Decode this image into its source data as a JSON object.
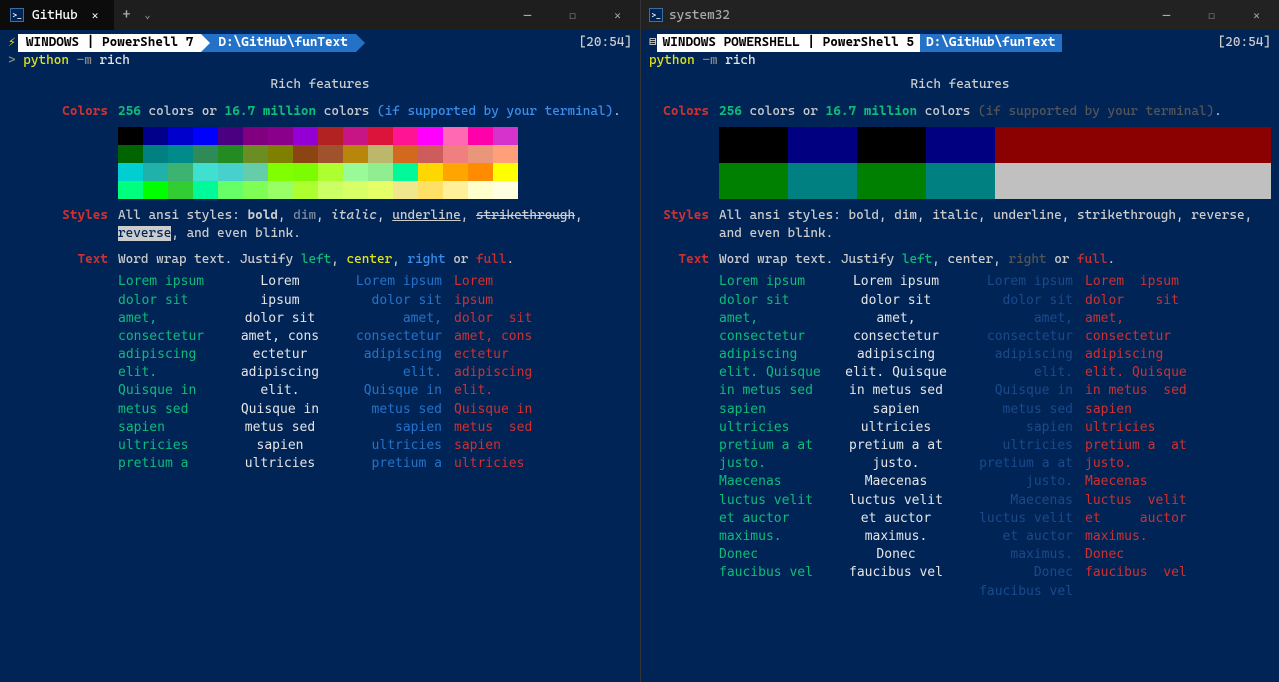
{
  "left": {
    "tab_title": "GitHub",
    "time": "[20:54]",
    "prompt_host": "WINDOWS | PowerShell 7",
    "prompt_path": "D:\\GitHub\\funText",
    "cmd_prefix": ">",
    "cmd_python": "python",
    "cmd_flag": "-m",
    "cmd_arg": "rich",
    "heading": "Rich features",
    "colors_label": "Colors",
    "colors_256": "256",
    "colors_text1": "colors or",
    "colors_million": "16.7 million",
    "colors_text2": "colors",
    "colors_supp": "(if supported by your terminal)",
    "dot": ".",
    "styles_label": "Styles",
    "styles_text": "All ansi styles:",
    "styles_bold": "bold",
    "styles_dim": "dim",
    "styles_italic": "italic",
    "styles_underline": "underline",
    "styles_strike": "strikethrough",
    "styles_reverse": "reverse",
    "styles_tail": ", and even blink.",
    "text_label": "Text",
    "text_prefix": "Word wrap text. Justify",
    "text_left": "left",
    "text_center": "center",
    "text_right": "right",
    "text_or": "or",
    "text_full": "full",
    "lorem_left": "Lorem ipsum\ndolor sit\namet,\nconsectetur\nadipiscing\nelit.\nQuisque in\nmetus sed\nsapien\nultricies\npretium a",
    "lorem_center": "Lorem\nipsum\ndolor sit\namet, cons\nectetur\nadipiscing\nelit.\nQuisque in\nmetus sed\nsapien\nultricies",
    "lorem_right": "Lorem ipsum\ndolor sit\namet,\nconsectetur\nadipiscing\nelit.\nQuisque in\nmetus sed\nsapien\nultricies\npretium a",
    "lorem_full": "Lorem\nipsum\ndolor  sit\namet, cons\nectetur\nadipiscing\nelit.\nQuisque in\nmetus  sed\nsapien\nultricies"
  },
  "right": {
    "tab_title": "system32",
    "time": "[20:54]",
    "prompt_host": "WINDOWS POWERSHELL | PowerShell 5",
    "prompt_path": "D:\\GitHub\\funText",
    "cmd_python": "python",
    "cmd_flag": "-m",
    "cmd_arg": "rich",
    "heading": "Rich features",
    "colors_label": "Colors",
    "colors_256": "256",
    "colors_text1": "colors or",
    "colors_million": "16.7 million",
    "colors_text2": "colors",
    "colors_supp": "(if supported by your terminal)",
    "dot": ".",
    "styles_label": "Styles",
    "styles_body": "All ansi styles: bold, dim, italic, underline, strikethrough, reverse, and even blink.",
    "text_label": "Text",
    "text_prefix": "Word wrap text. Justify",
    "text_left": "left",
    "text_center": "center",
    "text_right": "right",
    "text_or": "or",
    "text_full": "full",
    "lorem": "Lorem ipsum\ndolor sit\namet,\nconsectetur\nadipiscing\nelit. Quisque\nin metus sed\nsapien\nultricies\npretium a at\njusto.\nMaecenas\nluctus velit\net auctor\nmaximus.\nDonec\nfaucibus vel",
    "lorem_right_col": "Lorem ipsum\ndolor sit\namet,\nconsectetur\nadipiscing\nelit.\nQuisque in\nmetus sed\nsapien\nultricies\npretium a at\njusto.\nMaecenas\nluctus velit\net auctor\nmaximus.\nDonec\nfaucibus vel",
    "lorem_full_col": "Lorem  ipsum\ndolor    sit\namet,\nconsectetur\nadipiscing\nelit. Quisque\nin metus  sed\nsapien\nultricies\npretium a  at\njusto.\nMaecenas\nluctus  velit\net     auctor\nmaximus.\nDonec\nfaucibus  vel"
  },
  "swatches_left": [
    [
      "#000000",
      "#00008b",
      "#0000cd",
      "#0000ff",
      "#4b0082",
      "#800080",
      "#8b008b",
      "#9400d3",
      "#b22222",
      "#c71585",
      "#dc143c",
      "#ff1493",
      "#ff00ff",
      "#ff69b4",
      "#ff00aa",
      "#d633cc"
    ],
    [
      "#006400",
      "#008080",
      "#008b8b",
      "#2e8b57",
      "#228b22",
      "#6b8e23",
      "#808000",
      "#8b4513",
      "#a0522d",
      "#b8860b",
      "#bdb76b",
      "#d2691e",
      "#cd5c5c",
      "#f08080",
      "#e9967a",
      "#ffa07a"
    ],
    [
      "#00ced1",
      "#20b2aa",
      "#3cb371",
      "#40e0d0",
      "#48d1cc",
      "#66cdaa",
      "#7fff00",
      "#7cfc00",
      "#adff2f",
      "#98fb98",
      "#90ee90",
      "#00fa9a",
      "#ffd700",
      "#ffa500",
      "#ff8c00",
      "#ffff00"
    ],
    [
      "#00ff7f",
      "#00ff00",
      "#32cd32",
      "#00fa9a",
      "#66ff66",
      "#7fff55",
      "#99ff66",
      "#adff2f",
      "#ccff66",
      "#d9ff66",
      "#e6ff66",
      "#f0e68c",
      "#ffe066",
      "#fff099",
      "#ffffcc",
      "#ffffe0"
    ]
  ],
  "swatches_right": [
    [
      "#000000",
      "#000080",
      "#000000",
      "#000080",
      "#8b0000",
      "#8b0000",
      "#8b0000",
      "#8b0000"
    ],
    [
      "#008000",
      "#008080",
      "#008000",
      "#008080",
      "#c0c0c0",
      "#c0c0c0",
      "#c0c0c0",
      "#c0c0c0"
    ]
  ]
}
